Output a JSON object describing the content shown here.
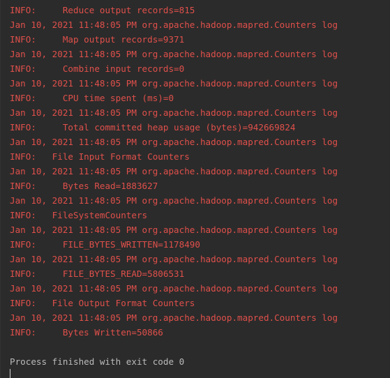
{
  "console": {
    "lines": [
      "INFO:     Reduce output records=815",
      "Jan 10, 2021 11:48:05 PM org.apache.hadoop.mapred.Counters log",
      "INFO:     Map output records=9371",
      "Jan 10, 2021 11:48:05 PM org.apache.hadoop.mapred.Counters log",
      "INFO:     Combine input records=0",
      "Jan 10, 2021 11:48:05 PM org.apache.hadoop.mapred.Counters log",
      "INFO:     CPU time spent (ms)=0",
      "Jan 10, 2021 11:48:05 PM org.apache.hadoop.mapred.Counters log",
      "INFO:     Total committed heap usage (bytes)=942669824",
      "Jan 10, 2021 11:48:05 PM org.apache.hadoop.mapred.Counters log",
      "INFO:   File Input Format Counters",
      "Jan 10, 2021 11:48:05 PM org.apache.hadoop.mapred.Counters log",
      "INFO:     Bytes Read=1883627",
      "Jan 10, 2021 11:48:05 PM org.apache.hadoop.mapred.Counters log",
      "INFO:   FileSystemCounters",
      "Jan 10, 2021 11:48:05 PM org.apache.hadoop.mapred.Counters log",
      "INFO:     FILE_BYTES_WRITTEN=1178490",
      "Jan 10, 2021 11:48:05 PM org.apache.hadoop.mapred.Counters log",
      "INFO:     FILE_BYTES_READ=5806531",
      "Jan 10, 2021 11:48:05 PM org.apache.hadoop.mapred.Counters log",
      "INFO:   File Output Format Counters",
      "Jan 10, 2021 11:48:05 PM org.apache.hadoop.mapred.Counters log",
      "INFO:     Bytes Written=50866"
    ],
    "finish_message": "Process finished with exit code 0"
  },
  "colors": {
    "background": "#2b2b2b",
    "log_text": "#e0504b",
    "normal_text": "#bbbbbb"
  }
}
